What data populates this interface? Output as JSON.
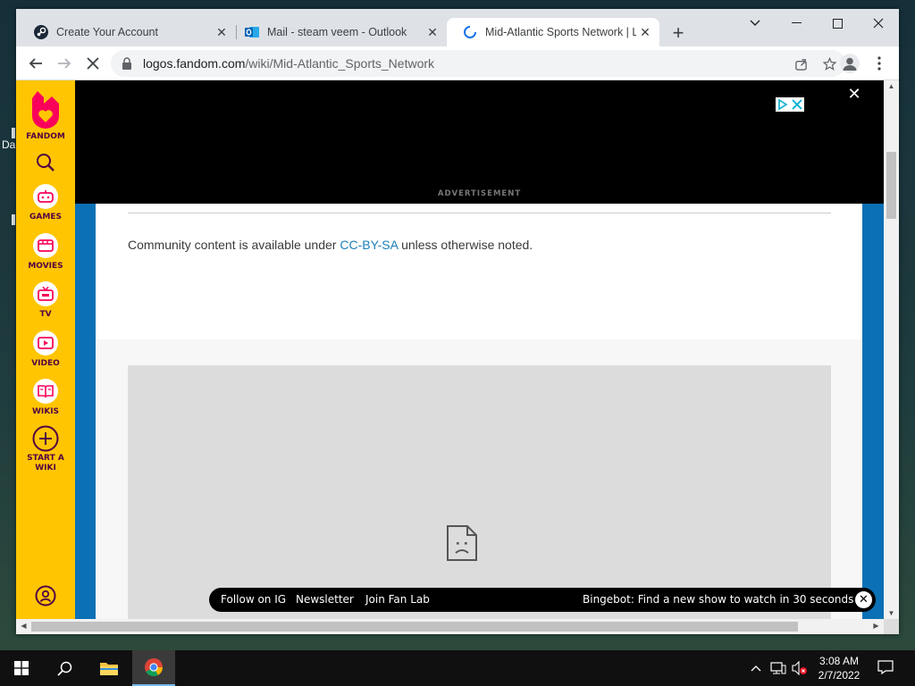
{
  "browser": {
    "tabs": [
      {
        "title": "Create Your Account",
        "icon": "steam-icon"
      },
      {
        "title": "Mail - steam veem - Outlook",
        "icon": "outlook-icon"
      },
      {
        "title": "Mid-Atlantic Sports Network | Lo",
        "icon": "loading-spinner-icon"
      }
    ],
    "new_tab_label": "+",
    "url_host": "logos.fandom.com",
    "url_path": "/wiki/Mid-Atlantic_Sports_Network"
  },
  "fandom_rail": {
    "logo_label": "FANDOM",
    "items": [
      {
        "label": "GAMES",
        "icon": "games-icon"
      },
      {
        "label": "MOVIES",
        "icon": "movies-icon"
      },
      {
        "label": "TV",
        "icon": "tv-icon"
      },
      {
        "label": "VIDEO",
        "icon": "video-icon"
      },
      {
        "label": "WIKIS",
        "icon": "wikis-icon"
      },
      {
        "label": "START A WIKI",
        "icon": "plus-circle-icon"
      }
    ]
  },
  "ad": {
    "label": "ADVERTISEMENT"
  },
  "content": {
    "license_prefix": "Community content is available under ",
    "license_link": "CC-BY-SA",
    "license_suffix": " unless otherwise noted."
  },
  "global_footer": {
    "links": [
      "Follow on IG",
      "Newsletter",
      "Join Fan Lab"
    ],
    "promo": "Bingebot: Find a new show to watch in 30 seconds"
  },
  "desktop": {
    "partial_label": "Da"
  },
  "taskbar": {
    "time": "3:08 AM",
    "date": "2/7/2022"
  },
  "colors": {
    "fandom_yellow": "#ffc500",
    "fandom_pink": "#fa005a",
    "fandom_blue": "#0b70b5",
    "link": "#1b7fb9"
  }
}
